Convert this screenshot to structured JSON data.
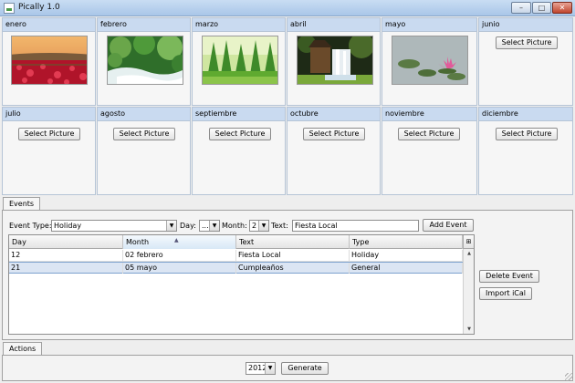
{
  "window": {
    "title": "Pically 1.0",
    "min_glyph": "–",
    "max_glyph": "□",
    "close_glyph": "✕"
  },
  "months": [
    {
      "name": "enero",
      "has_picture": true
    },
    {
      "name": "febrero",
      "has_picture": true
    },
    {
      "name": "marzo",
      "has_picture": true
    },
    {
      "name": "abril",
      "has_picture": true
    },
    {
      "name": "mayo",
      "has_picture": true
    },
    {
      "name": "junio",
      "has_picture": false,
      "button_label": "Select Picture"
    },
    {
      "name": "julio",
      "has_picture": false,
      "button_label": "Select Picture"
    },
    {
      "name": "agosto",
      "has_picture": false,
      "button_label": "Select Picture"
    },
    {
      "name": "septiembre",
      "has_picture": false,
      "button_label": "Select Picture"
    },
    {
      "name": "octubre",
      "has_picture": false,
      "button_label": "Select Picture"
    },
    {
      "name": "noviembre",
      "has_picture": false,
      "button_label": "Select Picture"
    },
    {
      "name": "diciembre",
      "has_picture": false,
      "button_label": "Select Picture"
    }
  ],
  "events": {
    "tab_label": "Events",
    "event_type_label": "Event Type:",
    "event_type_value": "Holiday",
    "day_label": "Day:",
    "day_value": "...",
    "month_label": "Month:",
    "month_value": "2",
    "text_label": "Text:",
    "text_value": "Fiesta Local",
    "add_button": "Add Event",
    "delete_button": "Delete Event",
    "import_button": "Import iCal",
    "columns": [
      "Day",
      "Month",
      "Text",
      "Type"
    ],
    "rows": [
      {
        "day": "12",
        "month": "02 febrero",
        "text": "Fiesta Local",
        "type": "Holiday"
      },
      {
        "day": "21",
        "month": "05 mayo",
        "text": "Cumpleaños",
        "type": "General"
      }
    ]
  },
  "actions": {
    "tab_label": "Actions",
    "year_value": "2012",
    "generate_button": "Generate"
  },
  "icons": [
    "app-icon",
    "minimize-icon",
    "maximize-icon",
    "close-icon",
    "dropdown-arrow-icon",
    "column-control-icon",
    "scroll-up-icon",
    "scroll-down-icon",
    "resize-grip-icon",
    "sort-indicator-icon"
  ],
  "colors": {
    "month_header": "#c9daf0",
    "selection": "#dbe5f3",
    "titlebar": "#b9d1ee"
  }
}
